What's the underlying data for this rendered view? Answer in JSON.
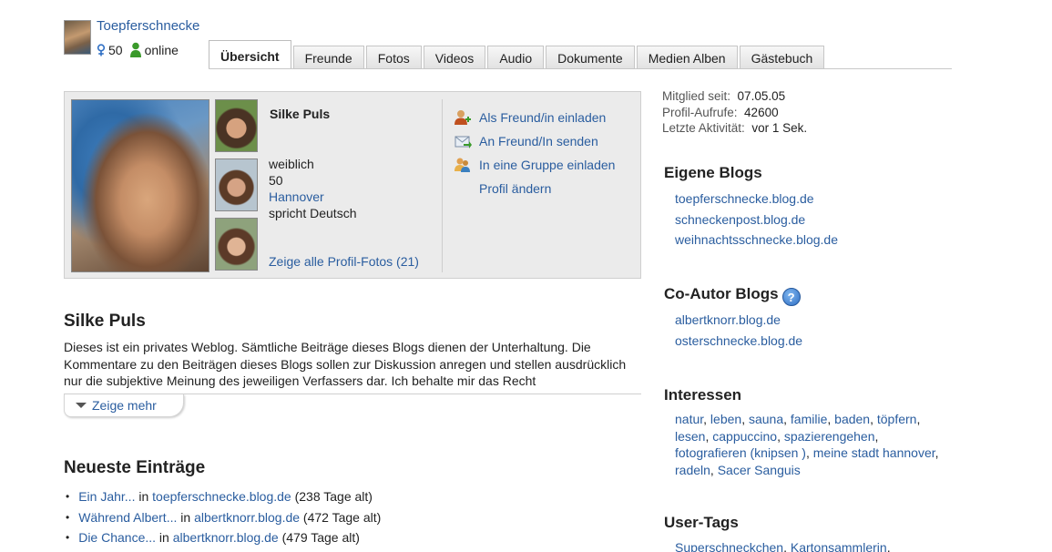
{
  "header": {
    "username": "Toepferschnecke",
    "age": "50",
    "online_label": "online"
  },
  "tabs": [
    {
      "label": "Übersicht",
      "active": true
    },
    {
      "label": "Freunde"
    },
    {
      "label": "Fotos"
    },
    {
      "label": "Videos"
    },
    {
      "label": "Audio"
    },
    {
      "label": "Dokumente"
    },
    {
      "label": "Medien Alben"
    },
    {
      "label": "Gästebuch"
    }
  ],
  "profile": {
    "name": "Silke Puls",
    "gender": "weiblich",
    "age": "50",
    "city": "Hannover",
    "language": "spricht Deutsch",
    "all_photos": "Zeige alle Profil-Fotos (21)",
    "actions": [
      {
        "label": "Als Freund/in einladen",
        "icon": "add-friend-icon"
      },
      {
        "label": "An Freund/In senden",
        "icon": "send-to-friend-icon"
      },
      {
        "label": "In eine Gruppe einladen",
        "icon": "group-invite-icon"
      },
      {
        "label": "Profil ändern",
        "icon": ""
      }
    ]
  },
  "about": {
    "title": "Silke Puls",
    "text": "Dieses ist ein privates Weblog. Sämtliche Beiträge dieses Blogs dienen der Unterhaltung. Die Kommentare zu den Beiträgen dieses Blogs sollen zur Diskussion anregen und stellen ausdrücklich nur die subjektive Meinung des jeweiligen Verfassers dar. Ich behalte mir das Recht",
    "show_more": "Zeige mehr"
  },
  "entries": {
    "title": "Neueste Einträge",
    "in_word": "in",
    "items": [
      {
        "title": "Ein Jahr...",
        "blog": "toepferschnecke.blog.de",
        "age": "(238 Tage alt)"
      },
      {
        "title": "Während Albert...",
        "blog": "albertknorr.blog.de",
        "age": "(472 Tage alt)"
      },
      {
        "title": "Die Chance...",
        "blog": "albertknorr.blog.de",
        "age": "(479 Tage alt)"
      }
    ]
  },
  "stats": {
    "member_since_label": "Mitglied seit:",
    "member_since": "07.05.05",
    "views_label": "Profil-Aufrufe:",
    "views": "42600",
    "last_activity_label": "Letzte Aktivität:",
    "last_activity": "vor 1 Sek."
  },
  "own_blogs": {
    "title": "Eigene Blogs",
    "items": [
      "toepferschnecke.blog.de",
      "schneckenpost.blog.de",
      "weihnachtsschnecke.blog.de"
    ]
  },
  "coauthor_blogs": {
    "title": "Co-Autor Blogs",
    "help": "?",
    "items": [
      "albertknorr.blog.de",
      "osterschnecke.blog.de"
    ]
  },
  "interests": {
    "title": "Interessen",
    "items": [
      "natur",
      "leben",
      "sauna",
      "familie",
      "baden",
      "töpfern",
      "lesen",
      "cappuccino",
      "spazierengehen",
      "fotografieren (knipsen )",
      "meine stadt hannover",
      "radeln",
      "Sacer Sanguis"
    ]
  },
  "user_tags": {
    "title": "User-Tags",
    "items": [
      "Superschneckchen",
      "Kartonsammlerin"
    ]
  },
  "colors": {
    "link": "#2a5d9f",
    "box_bg": "#ebebeb",
    "online_green": "#3a9a2a"
  }
}
